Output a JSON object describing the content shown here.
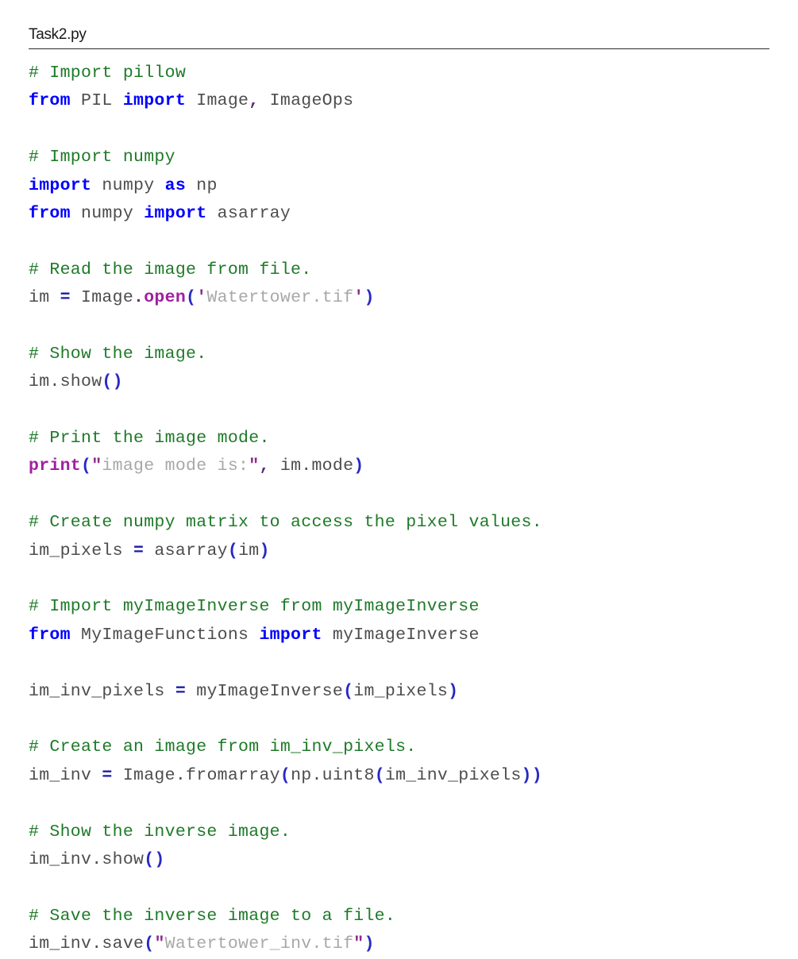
{
  "document": {
    "title": "Task2.py",
    "language": "python",
    "colors": {
      "comment": "#1e7a28",
      "keyword": "#0000ff",
      "builtin": "#a020a0",
      "punctuation": "#2929c4",
      "string": "#a8a8a8",
      "plain": "#4d4d4d",
      "background": "#ffffff",
      "rule": "#2b2b2b"
    },
    "code_lines": [
      {
        "id": "l1",
        "text": "# Import pillow"
      },
      {
        "id": "l2",
        "text": "from PIL import Image, ImageOps"
      },
      {
        "id": "l3",
        "text": ""
      },
      {
        "id": "l4",
        "text": "# Import numpy"
      },
      {
        "id": "l5",
        "text": "import numpy as np"
      },
      {
        "id": "l6",
        "text": "from numpy import asarray"
      },
      {
        "id": "l7",
        "text": ""
      },
      {
        "id": "l8",
        "text": "# Read the image from file."
      },
      {
        "id": "l9",
        "text": "im = Image.open('Watertower.tif')"
      },
      {
        "id": "l10",
        "text": ""
      },
      {
        "id": "l11",
        "text": "# Show the image."
      },
      {
        "id": "l12",
        "text": "im.show()"
      },
      {
        "id": "l13",
        "text": ""
      },
      {
        "id": "l14",
        "text": "# Print the image mode."
      },
      {
        "id": "l15",
        "text": "print(\"image mode is:\", im.mode)"
      },
      {
        "id": "l16",
        "text": ""
      },
      {
        "id": "l17",
        "text": "# Create numpy matrix to access the pixel values."
      },
      {
        "id": "l18",
        "text": "im_pixels = asarray(im)"
      },
      {
        "id": "l19",
        "text": ""
      },
      {
        "id": "l20",
        "text": "# Import myImageInverse from myImageInverse"
      },
      {
        "id": "l21",
        "text": "from MyImageFunctions import myImageInverse"
      },
      {
        "id": "l22",
        "text": ""
      },
      {
        "id": "l23",
        "text": "im_inv_pixels = myImageInverse(im_pixels)"
      },
      {
        "id": "l24",
        "text": ""
      },
      {
        "id": "l25",
        "text": "# Create an image from im_inv_pixels."
      },
      {
        "id": "l26",
        "text": "im_inv = Image.fromarray(np.uint8(im_inv_pixels))"
      },
      {
        "id": "l27",
        "text": ""
      },
      {
        "id": "l28",
        "text": "# Show the inverse image."
      },
      {
        "id": "l29",
        "text": "im_inv.show()"
      },
      {
        "id": "l30",
        "text": ""
      },
      {
        "id": "l31",
        "text": "# Save the inverse image to a file."
      },
      {
        "id": "l32",
        "text": "im_inv.save(\"Watertower_inv.tif\")"
      }
    ],
    "tokens": {
      "l1": [
        [
          "comment",
          "# Import pillow"
        ]
      ],
      "l2": [
        [
          "kw",
          "from"
        ],
        [
          "plain",
          " PIL "
        ],
        [
          "kw",
          "import"
        ],
        [
          "plain",
          " Image"
        ],
        [
          "quote2",
          ","
        ],
        [
          "plain",
          " ImageOps"
        ]
      ],
      "l4": [
        [
          "comment",
          "# Import numpy"
        ]
      ],
      "l5": [
        [
          "kw",
          "import"
        ],
        [
          "plain",
          " numpy "
        ],
        [
          "kw",
          "as"
        ],
        [
          "plain",
          " np"
        ]
      ],
      "l6": [
        [
          "kw",
          "from"
        ],
        [
          "plain",
          " numpy "
        ],
        [
          "kw",
          "import"
        ],
        [
          "plain",
          " asarray"
        ]
      ],
      "l8": [
        [
          "comment",
          "# Read the image from file."
        ]
      ],
      "l9": [
        [
          "plain",
          "im "
        ],
        [
          "op",
          "="
        ],
        [
          "plain",
          " Image"
        ],
        [
          "dot",
          "."
        ],
        [
          "builtin",
          "open"
        ],
        [
          "punct",
          "("
        ],
        [
          "quote",
          "'"
        ],
        [
          "str",
          "Watertower.tif"
        ],
        [
          "quote",
          "'"
        ],
        [
          "punct",
          ")"
        ]
      ],
      "l11": [
        [
          "comment",
          "# Show the image."
        ]
      ],
      "l12": [
        [
          "plain",
          "im.show"
        ],
        [
          "punct",
          "()"
        ]
      ],
      "l14": [
        [
          "comment",
          "# Print the image mode."
        ]
      ],
      "l15": [
        [
          "builtin",
          "print"
        ],
        [
          "punct",
          "("
        ],
        [
          "quote",
          "\""
        ],
        [
          "str",
          "image mode is:"
        ],
        [
          "quote",
          "\""
        ],
        [
          "quote2",
          ","
        ],
        [
          "plain",
          " im.mode"
        ],
        [
          "punct",
          ")"
        ]
      ],
      "l17": [
        [
          "comment",
          "# Create numpy matrix to access the pixel values."
        ]
      ],
      "l18": [
        [
          "plain",
          "im_pixels "
        ],
        [
          "op",
          "="
        ],
        [
          "plain",
          " asarray"
        ],
        [
          "punct",
          "("
        ],
        [
          "plain",
          "im"
        ],
        [
          "punct",
          ")"
        ]
      ],
      "l20": [
        [
          "comment",
          "# Import myImageInverse from myImageInverse"
        ]
      ],
      "l21": [
        [
          "kw",
          "from"
        ],
        [
          "plain",
          " MyImageFunctions "
        ],
        [
          "kw",
          "import"
        ],
        [
          "plain",
          " myImageInverse"
        ]
      ],
      "l23": [
        [
          "plain",
          "im_inv_pixels "
        ],
        [
          "op",
          "="
        ],
        [
          "plain",
          " myImageInverse"
        ],
        [
          "punct",
          "("
        ],
        [
          "plain",
          "im_pixels"
        ],
        [
          "punct",
          ")"
        ]
      ],
      "l25": [
        [
          "comment",
          "# Create an image from im_inv_pixels."
        ]
      ],
      "l26": [
        [
          "plain",
          "im_inv "
        ],
        [
          "op",
          "="
        ],
        [
          "plain",
          " Image.fromarray"
        ],
        [
          "punct",
          "("
        ],
        [
          "plain",
          "np.uint8"
        ],
        [
          "punct",
          "("
        ],
        [
          "plain",
          "im_inv_pixels"
        ],
        [
          "punct",
          "))"
        ]
      ],
      "l28": [
        [
          "comment",
          "# Show the inverse image."
        ]
      ],
      "l29": [
        [
          "plain",
          "im_inv.show"
        ],
        [
          "punct",
          "()"
        ]
      ],
      "l31": [
        [
          "comment",
          "# Save the inverse image to a file."
        ]
      ],
      "l32": [
        [
          "plain",
          "im_inv.save"
        ],
        [
          "punct",
          "("
        ],
        [
          "quote",
          "\""
        ],
        [
          "str",
          "Watertower_inv.tif"
        ],
        [
          "quote",
          "\""
        ],
        [
          "punct",
          ")"
        ]
      ]
    }
  }
}
